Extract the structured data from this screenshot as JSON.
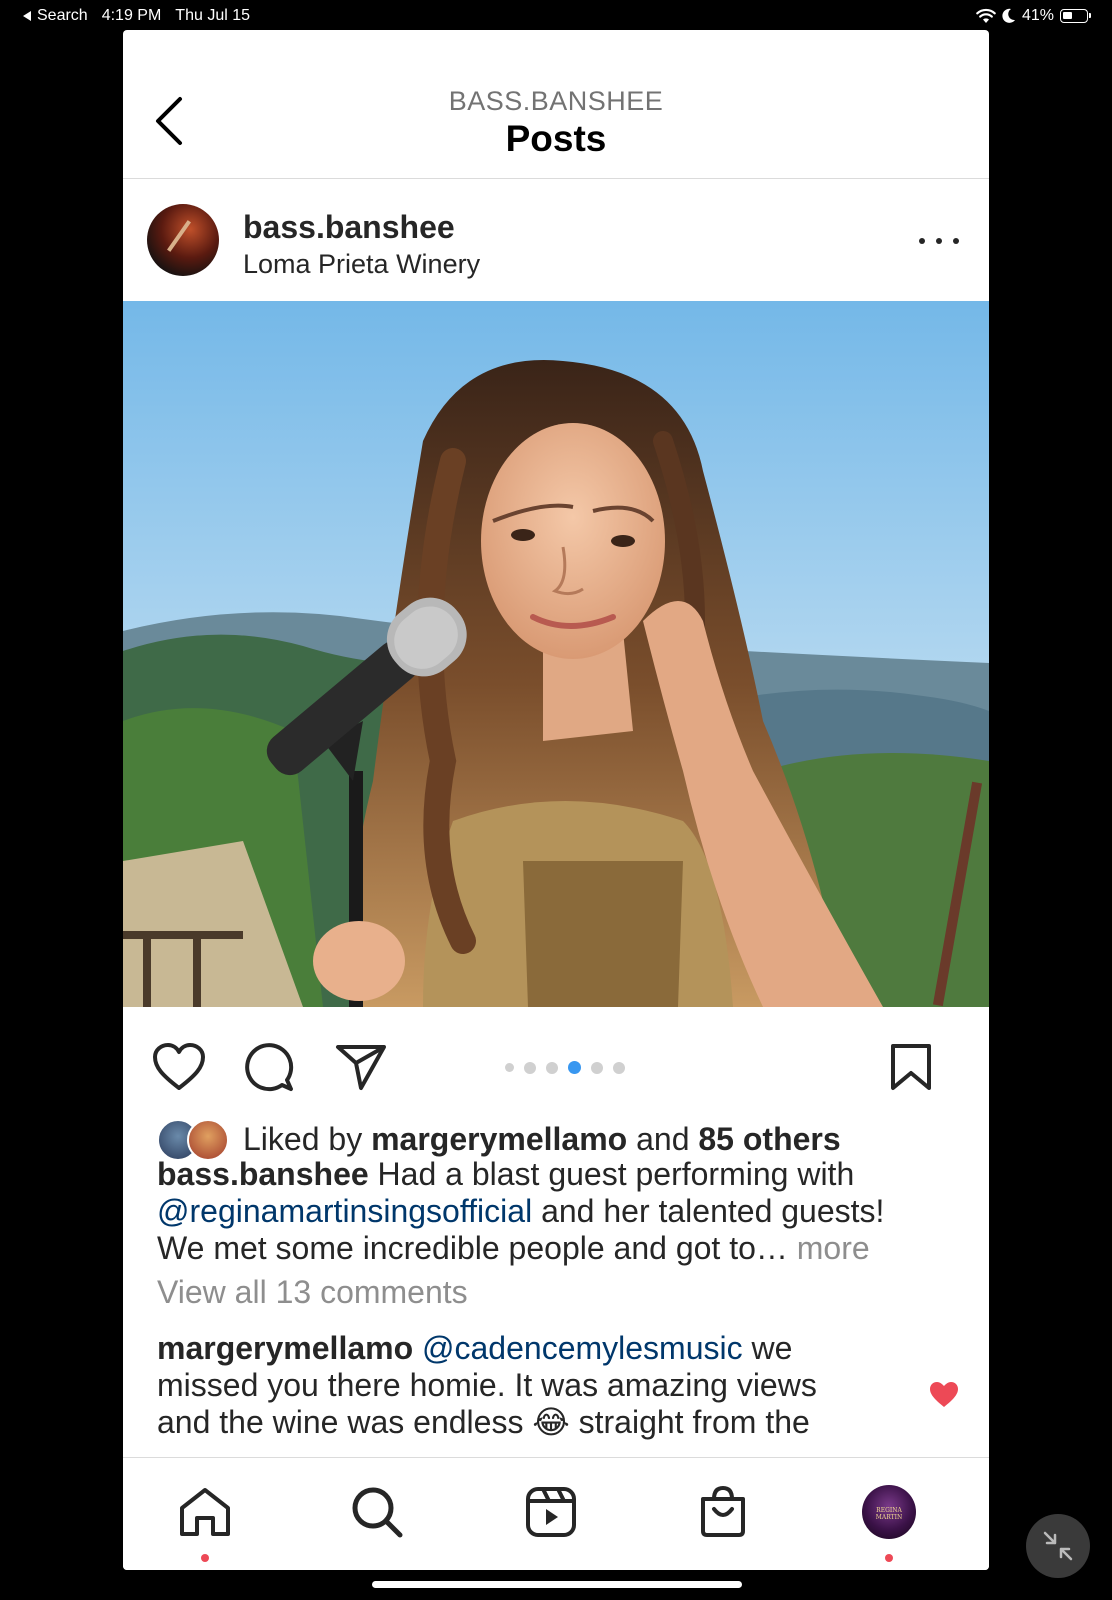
{
  "status_bar": {
    "back_label": "Search",
    "time": "4:19 PM",
    "date": "Thu Jul 15",
    "battery_percent": "41%",
    "battery_level": 0.41
  },
  "header": {
    "subtitle": "BASS.BANSHEE",
    "title": "Posts"
  },
  "post": {
    "username": "bass.banshee",
    "location": "Loma Prieta Winery",
    "carousel": {
      "count": 6,
      "active_index": 3
    },
    "likes": {
      "prefix": "Liked by ",
      "liker": "margerymellamo",
      "middle": " and ",
      "others": "85 others"
    },
    "caption": {
      "username": "bass.banshee",
      "text1": " Had a blast guest performing with",
      "mention": "@reginamartinsingsofficial",
      "text2": " and her talented guests!",
      "text3": "We met some incredible people and got to… ",
      "more": "more"
    },
    "view_comments": "View all 13 comments",
    "comment": {
      "username": "margerymellamo",
      "mention": "@cadencemylesmusic",
      "text1": " we",
      "text2": "missed you there homie. It was amazing views",
      "text3": "and the wine was endless 😂 straight from the"
    }
  },
  "profile_tab_text": "REGINA MARTIN",
  "colors": {
    "accent_blue": "#3897f0",
    "mention": "#00376b",
    "notification": "#ed4956"
  }
}
